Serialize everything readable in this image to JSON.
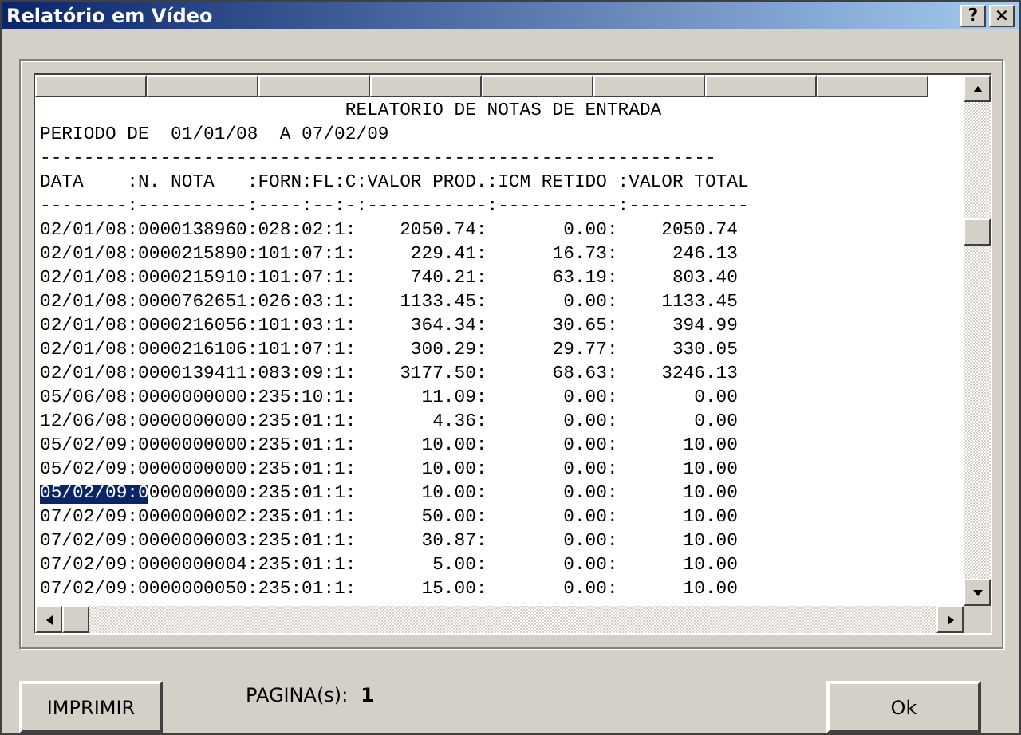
{
  "window": {
    "title": "Relatório em Vídeo",
    "buttons": [
      "?",
      "×"
    ]
  },
  "report": {
    "lines": [
      {
        "text": "                            RELATORIO DE NOTAS DE ENTRADA"
      },
      {
        "text": "PERIODO DE  01/01/08  A 07/02/09"
      },
      {
        "text": "--------------------------------------------------------------"
      },
      {
        "text": "DATA    :N. NOTA   :FORN:FL:C:VALOR PROD.:ICM RETIDO :VALOR TOTAL"
      },
      {
        "text": "--------:----------:----:--:-:-----------:-----------:-----------"
      },
      {
        "text": "02/01/08:0000138960:028:02:1:    2050.74:       0.00:    2050.74"
      },
      {
        "text": "02/01/08:0000215890:101:07:1:     229.41:      16.73:     246.13"
      },
      {
        "text": "02/01/08:0000215910:101:07:1:     740.21:      63.19:     803.40"
      },
      {
        "text": "02/01/08:0000762651:026:03:1:    1133.45:       0.00:    1133.45"
      },
      {
        "text": "02/01/08:0000216056:101:03:1:     364.34:      30.65:     394.99"
      },
      {
        "text": "02/01/08:0000216106:101:07:1:     300.29:      29.77:     330.05"
      },
      {
        "text": "02/01/08:0000139411:083:09:1:    3177.50:      68.63:    3246.13"
      },
      {
        "text": "05/06/08:0000000000:235:10:1:      11.09:       0.00:       0.00"
      },
      {
        "text": "12/06/08:0000000000:235:01:1:       4.36:       0.00:       0.00"
      },
      {
        "text": "05/02/09:0000000000:235:01:1:      10.00:       0.00:      10.00"
      },
      {
        "text": "05/02/09:0000000000:235:01:1:      10.00:       0.00:      10.00"
      },
      {
        "highlighted": "05/02/09:0",
        "text": "000000000:235:01:1:      10.00:       0.00:      10.00"
      },
      {
        "text": "07/02/09:0000000002:235:01:1:      50.00:       0.00:      10.00"
      },
      {
        "text": "07/02/09:0000000003:235:01:1:      30.87:       0.00:      10.00"
      },
      {
        "text": "07/02/09:0000000004:235:01:1:       5.00:       0.00:      10.00"
      },
      {
        "text": "07/02/09:0000000050:235:01:1:      15.00:       0.00:      10.00"
      }
    ]
  },
  "footer": {
    "print_button": "IMPRIMIR",
    "pages_label": "PAGINA(s):",
    "pages_value": "1",
    "ok_button": "Ok"
  }
}
